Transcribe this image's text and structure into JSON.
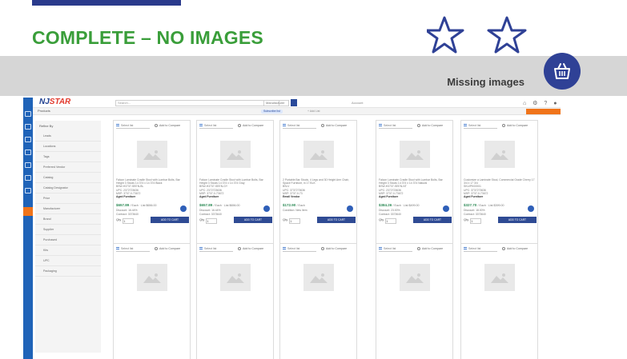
{
  "slide": {
    "title": "COMPLETE – NO IMAGES",
    "band_label": "Missing images",
    "icons": [
      "star-outline-icon",
      "star-outline-icon",
      "shopping-basket-icon"
    ],
    "colors": {
      "title_green": "#3a9e3a",
      "accent_navy": "#2a3a8c",
      "band_grey": "#d6d6d6"
    }
  },
  "app": {
    "logo_prefix": "NJ",
    "logo_suffix": "STAR",
    "search_placeholder": "Search...",
    "manufacturer_select": "Manufacturer",
    "account_text": "Account",
    "top_icons": "⌂ ⚙ ? ●",
    "breadcrumb": "Products",
    "pills": [
      "Subscribe list",
      "+ Add List"
    ],
    "colors": {
      "rail_blue": "#1f63b8",
      "orange": "#f0741a",
      "price_green": "#2e8b57",
      "button_navy": "#2f4b94"
    },
    "filters": {
      "heading": "Refine By",
      "items": [
        "Leads",
        "Locations",
        "Tags",
        "Preferred Vendor",
        "Catalog",
        "Catalog Designator",
        "Price",
        "Manufacturer",
        "Brand",
        "Supplier",
        "Purchased",
        "Kits",
        "UPC",
        "Packaging"
      ]
    },
    "product_cards": [
      {
        "select_label": "Select list",
        "compare_label": "Add to Compare",
        "desc": "Falcon Laminate Cradle Stool with Lumbar Bolts, Bar Height 3 Stools 14 374 x 14 374 Black",
        "sku": "BSW-H3737-SEEN-BL",
        "upc": "UPC: 2372723636",
        "mfr": "MSP: 3737-0-73672",
        "vendor": "Aged Furniture",
        "price": "$657.89",
        "each": "/ Each · List $656.00",
        "discount": "Discount: 16.44%",
        "contract": "Contract: 3373640",
        "qty_label": "Qty",
        "qty_value": "1",
        "add_label": "ADD TO CART"
      },
      {
        "select_label": "Select list",
        "compare_label": "Add to Compare",
        "desc": "Falcon Laminate Cradle Stool with Lumbar Bolts, Bar Height 3 Stools 14 374 x 14 374 Gray",
        "sku": "BSW-H3737-SEEN-GY",
        "upc": "UPC: 2372723636",
        "mfr": "MSP: 3737-0-73672",
        "vendor": "Aged Furniture",
        "price": "$657.89",
        "each": "/ Each · List $656.00",
        "discount": "Discount: 16.44%",
        "contract": "Contract: 3373640",
        "qty_label": "Qty",
        "qty_value": "1",
        "add_label": "ADD TO CART"
      },
      {
        "select_label": "Select list",
        "compare_label": "Add to Compare",
        "desc": "2 Portable Bar Stools, 4 Legs and 30 Height Arm Chair, Space Furniture, in 17 BLK",
        "sku": "BSLV",
        "upc": "UPC: 3737273636",
        "mfr": "MSP: 3737-0-73",
        "vendor": "Email Vendor",
        "price": "$172.90",
        "each": "/ Each",
        "discount": "Condition: New Item",
        "contract": "",
        "qty_label": "Qty",
        "qty_value": "1",
        "add_label": "ADD TO CART"
      },
      {
        "select_label": "Select list",
        "compare_label": "Add to Compare",
        "desc": "Falcon Laminate Cradle Stool with Lumbar Bolts, Bar Height 3 Stools 14 374 x 14 374 Natural",
        "sku": "BSW-H3737-SEEN-NT",
        "upc": "UPC: 2372723636",
        "mfr": "MSP: 3737-0-73672",
        "vendor": "Aged Furniture",
        "price": "$384.26",
        "each": "/ Each · List $499.00",
        "discount": "Discount: 23.00%",
        "contract": "Contract: 3373640",
        "qty_label": "Qty",
        "qty_value": "1",
        "add_label": "ADD TO CART"
      },
      {
        "select_label": "Select list",
        "compare_label": "Add to Compare",
        "desc": "Customize a Laminate Stool, Commercial Grade Cherry 17 3/4 x 17 3/4",
        "sku": "SKU/PK00001",
        "upc": "UPC: 3737273636",
        "mfr": "MSP: 3737-0-73672",
        "vendor": "Aged Furniture",
        "price": "$327.70",
        "each": "/ Each · List $399.00",
        "discount": "Discount: 18.00%",
        "contract": "Contract: 3373640",
        "qty_label": "Qty",
        "qty_value": "1",
        "add_label": "ADD TO CART"
      },
      {
        "select_label": "Select list",
        "compare_label": "Add to Compare"
      },
      {
        "select_label": "Select list",
        "compare_label": "Add to Compare"
      },
      {
        "select_label": "Select list",
        "compare_label": "Add to Compare"
      },
      {
        "select_label": "Select list",
        "compare_label": "Add to Compare"
      },
      {
        "select_label": "Select list",
        "compare_label": "Add to Compare"
      }
    ]
  }
}
